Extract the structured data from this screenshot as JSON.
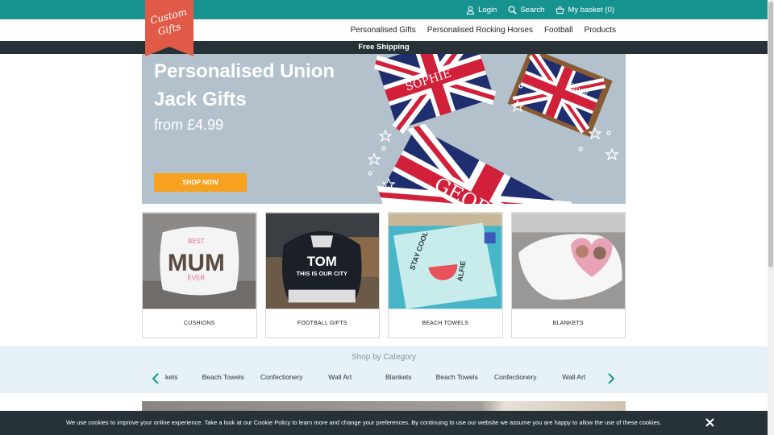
{
  "brand": {
    "logo_text": "Custom Gifts"
  },
  "topnav": {
    "login": "Login",
    "search": "Search",
    "basket": "My basket (0)"
  },
  "mainnav": [
    "Personalised Gifts",
    "Personalised Rocking Horses",
    "Football",
    "Products"
  ],
  "shipping_banner": "Free Shipping",
  "hero": {
    "title": "Personalised Union Jack Gifts",
    "subtitle": "from £4.99",
    "cta": "SHOP NOW",
    "names": [
      "SOPHIE",
      "GEORGE",
      "Olivia"
    ]
  },
  "products": [
    {
      "label": "CUSHIONS",
      "image_text": [
        "BEST",
        "MUM",
        "EVER"
      ]
    },
    {
      "label": "FOOTBALL GIFTS",
      "image_text": [
        "TOM",
        "THIS IS OUR CITY"
      ]
    },
    {
      "label": "BEACH TOWELS",
      "image_text": [
        "STAY COOL",
        "ALFIE"
      ]
    },
    {
      "label": "BLANKETS",
      "image_text": []
    }
  ],
  "categories": {
    "title": "Shop by Category",
    "items": [
      "Blankets",
      "Beach Towels",
      "Confectionery",
      "Wall Art",
      "Blankets",
      "Beach Towels",
      "Confectionery",
      "Wall Art"
    ]
  },
  "cookie": {
    "message": "We use cookies to improve your online experience. Take a look at our Cookie Policy to learn more and change your preferences. By continuing to use our website we assume you are happy to allow the use of these cookies."
  },
  "colors": {
    "teal": "#17938f",
    "dark": "#263238",
    "orange": "#f6a21e",
    "logo_red": "#e05a47",
    "hero_bg": "#b3c1cd",
    "category_bg": "#e6f1f8"
  }
}
